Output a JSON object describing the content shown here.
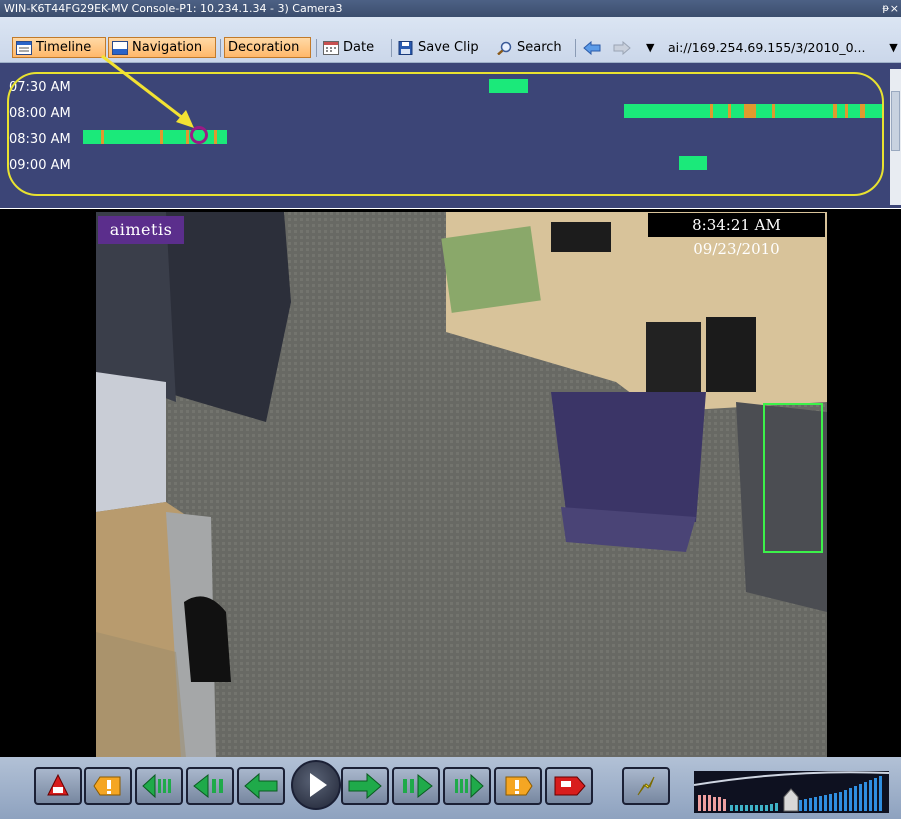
{
  "window": {
    "title": "WIN-K6T44FG29EK-MV Console-P1: 10.234.1.34 - 3) Camera3",
    "pin_glyph": "ᵽ",
    "close_glyph": "×"
  },
  "toolbar": {
    "timeline_label": "Timeline",
    "navigation_label": "Navigation",
    "decoration_label": "Decoration",
    "date_label": "Date",
    "save_clip_label": "Save Clip",
    "search_label": "Search",
    "address": "ai://169.254.69.155/3/2010_0...",
    "address_dropdown": "▼",
    "nav_dropdown": "▼"
  },
  "timeline": {
    "rows": [
      {
        "label": "07:30 AM"
      },
      {
        "label": "08:00 AM"
      },
      {
        "label": "08:30 AM"
      },
      {
        "label": "09:00 AM"
      }
    ],
    "colors": {
      "background": "#3c4577",
      "motion": "#1be97a",
      "alarm": "#e09a2e",
      "highlight": "#e8e230",
      "marker": "#9c1a86"
    }
  },
  "video": {
    "logo_text": "aimetis",
    "timestamp": "8:34:21 AM 09/23/2010"
  },
  "controls": {
    "buttons": [
      {
        "name": "first-alarm-button",
        "icon": "red-bell-up-icon"
      },
      {
        "name": "prev-event-button",
        "icon": "orange-exclamation-left-icon"
      },
      {
        "name": "prev-frame-fast-button",
        "icon": "green-arrow-left-bars-icon"
      },
      {
        "name": "prev-frame-button",
        "icon": "green-arrow-left-bar-icon"
      },
      {
        "name": "rewind-button",
        "icon": "green-arrow-left-icon"
      },
      {
        "name": "forward-button",
        "icon": "green-arrow-right-icon"
      },
      {
        "name": "next-frame-button",
        "icon": "green-arrow-right-bar-icon"
      },
      {
        "name": "next-frame-fast-button",
        "icon": "green-arrow-right-bars-icon"
      },
      {
        "name": "next-event-button",
        "icon": "orange-exclamation-right-icon"
      },
      {
        "name": "last-alarm-button",
        "icon": "red-bell-down-icon"
      },
      {
        "name": "live-button",
        "icon": "lightning-icon"
      }
    ]
  }
}
